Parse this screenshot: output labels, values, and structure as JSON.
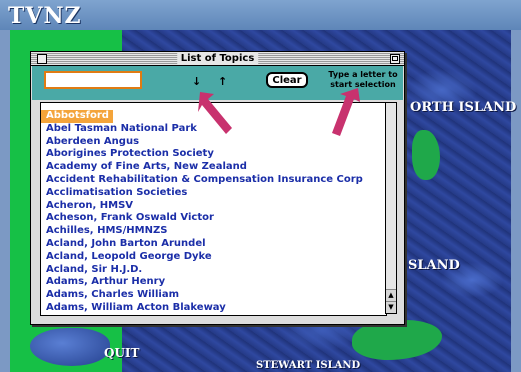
{
  "brand": {
    "logo_text": "TVNZ"
  },
  "map": {
    "label_north": "ORTH ISLAND",
    "label_south": "SLAND",
    "label_stewart": "STEWART ISLAND"
  },
  "quit_label": "QUIT",
  "window": {
    "title": "List of Topics",
    "search_value": "",
    "arrow_down": "↓",
    "arrow_up": "↑",
    "clear_label": "Clear",
    "hint_text": "Type a letter to start selection",
    "topics": [
      "Abbotsford",
      "Abel Tasman National Park",
      "Aberdeen Angus",
      "Aborigines Protection Society",
      "Academy of Fine Arts, New Zealand",
      "Accident Rehabilitation & Compensation Insurance Corp",
      "Acclimatisation Societies",
      "Acheron, HMSV",
      "Acheson, Frank Oswald Victor",
      "Achilles, HMS/HMNZS",
      "Acland, John Barton Arundel",
      "Acland, Leopold George Dyke",
      "Acland, Sir H.J.D.",
      "Adams, Arthur Henry",
      "Adams, Charles William",
      "Adams, William Acton Blakeway"
    ],
    "selected_index": 0
  },
  "colors": {
    "toolbar": "#4aa9a6",
    "selection": "#f4a43a",
    "list_text": "#1b2ea8",
    "annotation_arrow": "#c8326e"
  }
}
